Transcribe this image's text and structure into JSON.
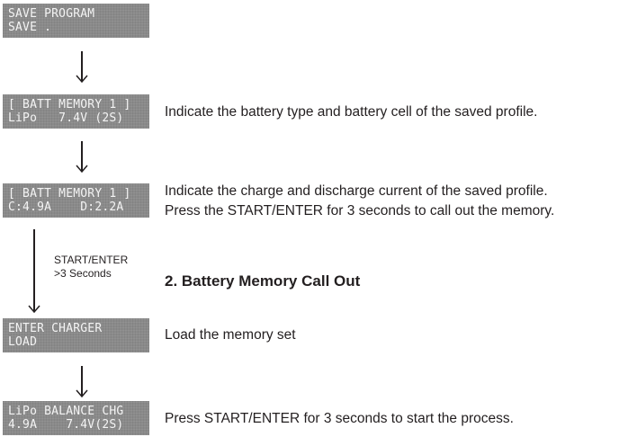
{
  "displays": [
    {
      "line1": "SAVE PROGRAM",
      "line2": "SAVE ."
    },
    {
      "line1": "[ BATT MEMORY 1 ]",
      "line2": "LiPo   7.4V (2S)"
    },
    {
      "line1": "[ BATT MEMORY 1 ]",
      "line2": "C:4.9A    D:2.2A"
    },
    {
      "line1": "ENTER CHARGER",
      "line2": "LOAD"
    },
    {
      "line1": "LiPo BALANCE CHG",
      "line2": "4.9A    7.4V(2S)"
    }
  ],
  "descriptions": {
    "battery_type": "Indicate the battery type and battery cell of the saved profile.",
    "current_line1": "Indicate the charge and discharge current of the saved profile.",
    "current_line2": "Press the START/ENTER for 3 seconds to call out the memory.",
    "load": "Load the memory set",
    "start": "Press START/ENTER for 3 seconds to start the process."
  },
  "step_note": {
    "line1": "START/ENTER",
    "line2": ">3  Seconds"
  },
  "section_heading": "2. Battery Memory Call Out",
  "icons": [
    "down-arrow-icon"
  ]
}
